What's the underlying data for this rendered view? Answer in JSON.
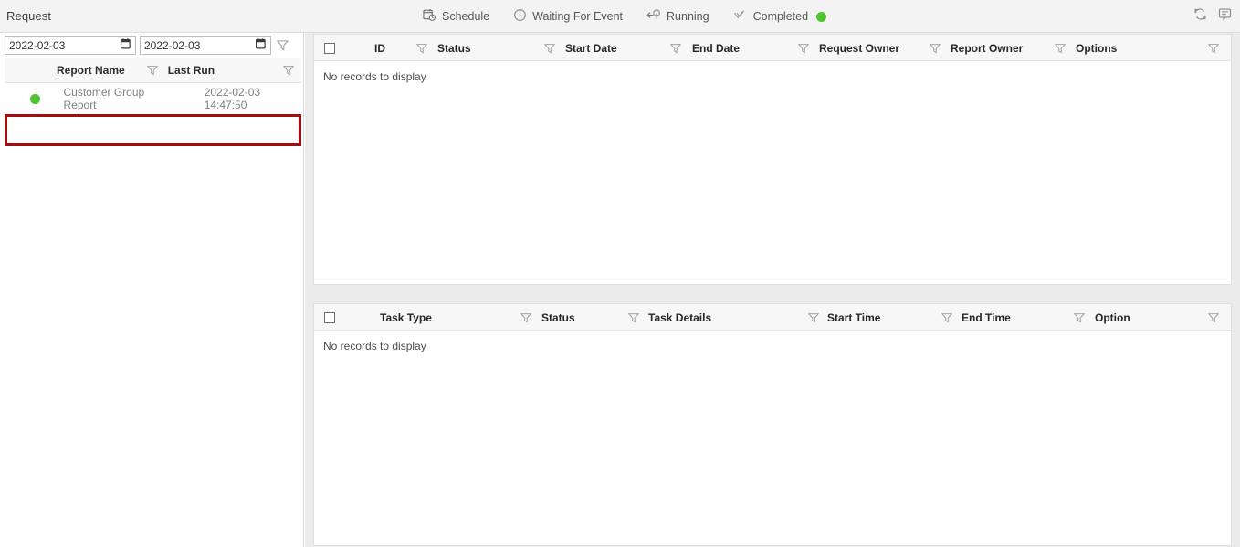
{
  "header": {
    "title": "Request",
    "tabs": [
      {
        "label": "Schedule",
        "icon": "calendar-clock-icon"
      },
      {
        "label": "Waiting For Event",
        "icon": "clock-icon"
      },
      {
        "label": "Running",
        "icon": "arrow-left-clock-icon"
      },
      {
        "label": "Completed",
        "icon": "double-check-icon",
        "status_dot": "#4ec52e"
      }
    ],
    "actions": [
      {
        "name": "refresh-icon"
      },
      {
        "name": "comment-icon"
      }
    ]
  },
  "left_panel": {
    "date_from": {
      "value": "2022-02-03",
      "placeholder": "2022-02-03"
    },
    "date_to": {
      "value": "2022-02-03",
      "placeholder": "2022-02-03"
    },
    "filter_icon": "funnel-icon",
    "columns": [
      {
        "label": "Report Name"
      },
      {
        "label": "Last Run"
      }
    ],
    "rows": [
      {
        "status_color": "#4ec52e",
        "report_name": "Customer Group Report",
        "last_run": "2022-02-03 14:47:50",
        "highlighted": true,
        "highlight_color": "#a30d10"
      }
    ]
  },
  "request_grid": {
    "columns": [
      {
        "label": "ID"
      },
      {
        "label": "Status"
      },
      {
        "label": "Start Date"
      },
      {
        "label": "End Date"
      },
      {
        "label": "Request Owner"
      },
      {
        "label": "Report Owner"
      },
      {
        "label": "Options"
      }
    ],
    "empty_message": "No records to display"
  },
  "task_grid": {
    "columns": [
      {
        "label": "Task Type"
      },
      {
        "label": "Status"
      },
      {
        "label": "Task Details"
      },
      {
        "label": "Start Time"
      },
      {
        "label": "End Time"
      },
      {
        "label": "Option"
      }
    ],
    "empty_message": "No records to display"
  }
}
